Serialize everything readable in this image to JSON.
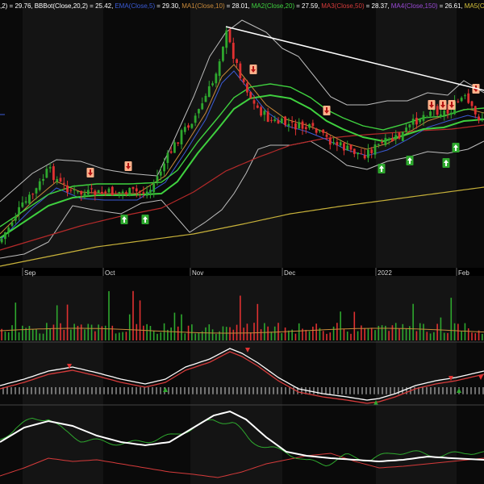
{
  "legend": [
    {
      "text": ",2) = 29.76,",
      "color": "#ffffff"
    },
    {
      "text": "BBBot(Close,20,2) = 25.42,",
      "color": "#ffffff"
    },
    {
      "text": "EMA(Close,5)",
      "color": "#3b5bd6"
    },
    {
      "text": "= 29.30,",
      "color": "#ffffff"
    },
    {
      "text": "MA1(Close,10)",
      "color": "#c98a3a"
    },
    {
      "text": "= 28.01,",
      "color": "#ffffff"
    },
    {
      "text": "MA2(Close,20)",
      "color": "#3fd13f"
    },
    {
      "text": "= 27.59,",
      "color": "#ffffff"
    },
    {
      "text": "MA3(Close,50)",
      "color": "#d63b3b"
    },
    {
      "text": "= 28.37,",
      "color": "#ffffff"
    },
    {
      "text": "MA4(Close,150)",
      "color": "#9a4ad6"
    },
    {
      "text": "= 26.61,",
      "color": "#ffffff"
    },
    {
      "text": "MA5(Cl",
      "color": "#d6c23b"
    }
  ],
  "time_axis": {
    "labels": [
      "Sep",
      "Oct",
      "Nov",
      "Dec",
      "2022",
      "Feb"
    ]
  },
  "colors": {
    "background": "#000000",
    "panel_alt": "#141414",
    "up": "#2ea82e",
    "down": "#e03131",
    "bollinger": "#bdbdbd",
    "ma2": "#3fd13f",
    "ma3": "#b52a2a",
    "ma5": "#c8b23a",
    "trend": "#ffffff",
    "signal_up": "#2ea82e",
    "signal_down": "#ffb18a"
  }
}
